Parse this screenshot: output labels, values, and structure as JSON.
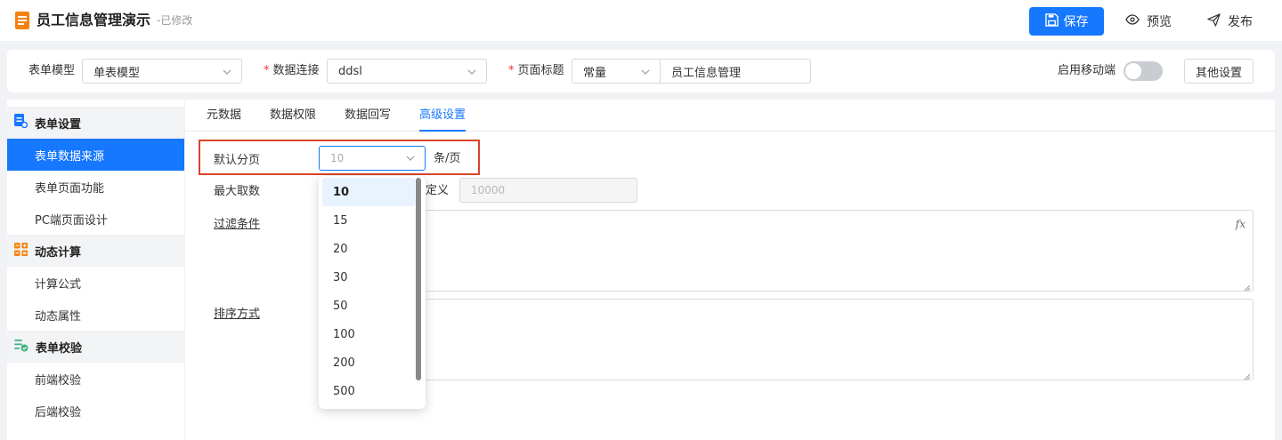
{
  "header": {
    "title": "员工信息管理演示",
    "status": "-已修改",
    "save_label": "保存",
    "preview_label": "预览",
    "publish_label": "发布",
    "accent": "#1677ff"
  },
  "config": {
    "form_model_label": "表单模型",
    "form_model_value": "单表模型",
    "data_conn_label": "数据连接",
    "data_conn_value": "ddsl",
    "page_title_label": "页面标题",
    "page_title_type": "常量",
    "page_title_value": "员工信息管理",
    "mobile_label": "启用移动端",
    "mobile_enabled": false,
    "other_settings_label": "其他设置"
  },
  "sidebar": {
    "groups": [
      {
        "label": "表单设置",
        "icon": "form-settings-icon",
        "items": [
          "表单数据来源",
          "表单页面功能",
          "PC端页面设计"
        ]
      },
      {
        "label": "动态计算",
        "icon": "calculation-grid-icon",
        "items": [
          "计算公式",
          "动态属性"
        ]
      },
      {
        "label": "表单校验",
        "icon": "validation-icon",
        "items": [
          "前端校验",
          "后端校验"
        ]
      }
    ],
    "active_item": "表单数据来源"
  },
  "tabs": [
    "元数据",
    "数据权限",
    "数据回写",
    "高级设置"
  ],
  "active_tab": "高级设置",
  "advanced": {
    "page_size_label": "默认分页",
    "page_size_value": "10",
    "page_size_unit": "条/页",
    "max_fetch_label": "最大取数",
    "max_fetch_partial_label": "定义",
    "max_fetch_value": "10000",
    "filter_label": "过滤条件",
    "fx_label": "fx",
    "sort_label": "排序方式"
  },
  "dropdown": {
    "options": [
      "10",
      "15",
      "20",
      "30",
      "50",
      "100",
      "200",
      "500"
    ],
    "selected": "10"
  }
}
